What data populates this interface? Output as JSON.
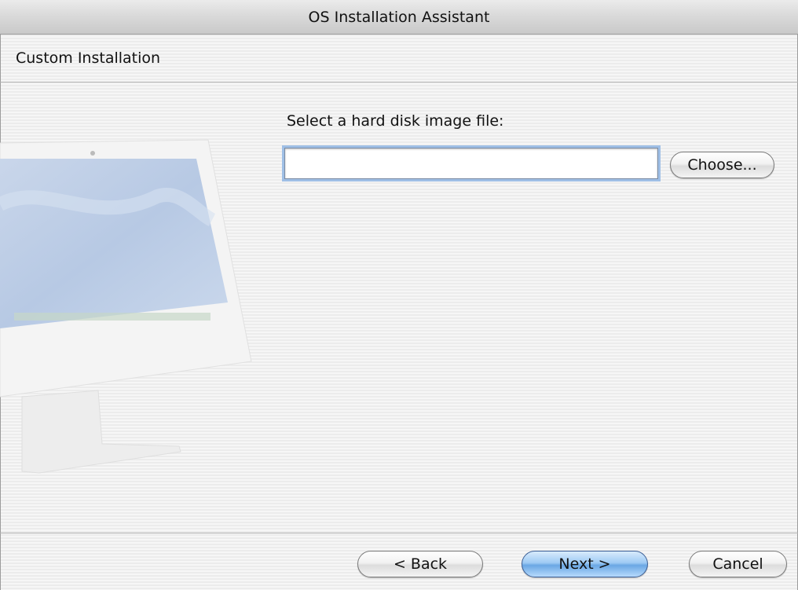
{
  "window": {
    "title": "OS Installation Assistant"
  },
  "step": {
    "title": "Custom Installation"
  },
  "form": {
    "prompt": "Select a hard disk image file:",
    "file_value": "",
    "choose_label": "Choose..."
  },
  "footer": {
    "back_label": "< Back",
    "next_label": "Next >",
    "cancel_label": "Cancel"
  },
  "colors": {
    "default_button": "#8fc2f0",
    "focus_ring": "#9fbfe6"
  },
  "icons": {
    "illustration": "imac-illustration"
  }
}
